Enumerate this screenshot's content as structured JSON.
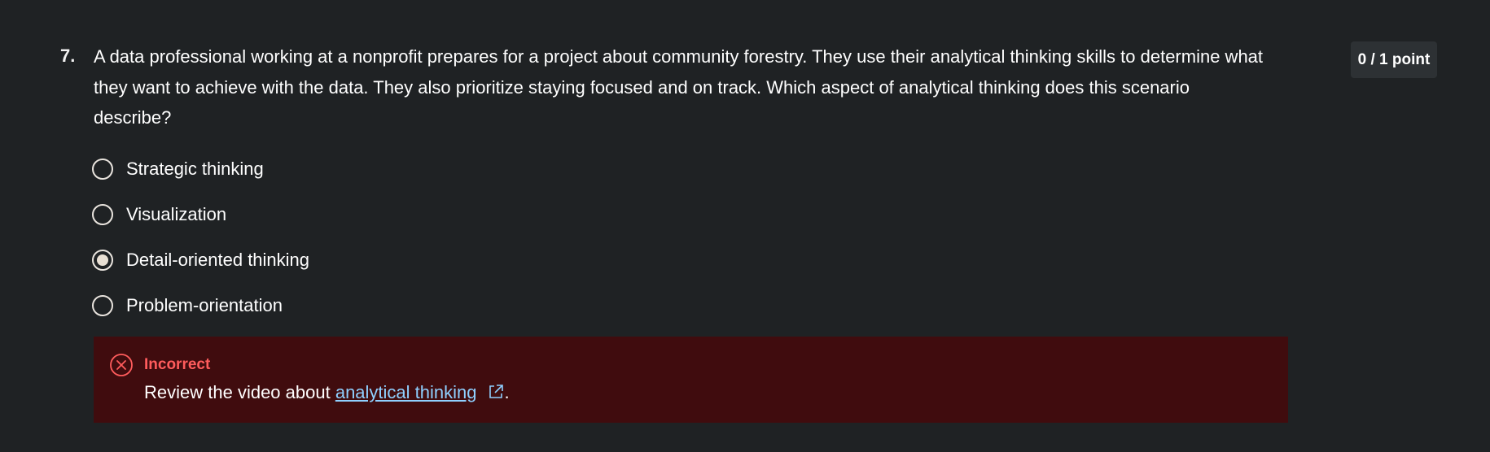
{
  "question": {
    "number": "7.",
    "text": "A data professional working at a nonprofit prepares for a project about community forestry. They use their analytical thinking skills to determine what they want to achieve with the data. They also prioritize staying focused and on track. Which aspect of analytical thinking does this scenario describe?",
    "score": "0 / 1 point"
  },
  "options": [
    {
      "label": "Strategic thinking",
      "selected": false
    },
    {
      "label": "Visualization",
      "selected": false
    },
    {
      "label": "Detail-oriented thinking",
      "selected": true
    },
    {
      "label": "Problem-orientation",
      "selected": false
    }
  ],
  "feedback": {
    "status": "Incorrect",
    "message_prefix": "Review the video about ",
    "link_text": "analytical thinking",
    "message_suffix": ".",
    "colors": {
      "background": "#400c0e",
      "status": "#ff5c5c",
      "link": "#8fd0ff"
    },
    "icons": {
      "status": "x-circle-icon",
      "link": "external-link-icon"
    }
  }
}
